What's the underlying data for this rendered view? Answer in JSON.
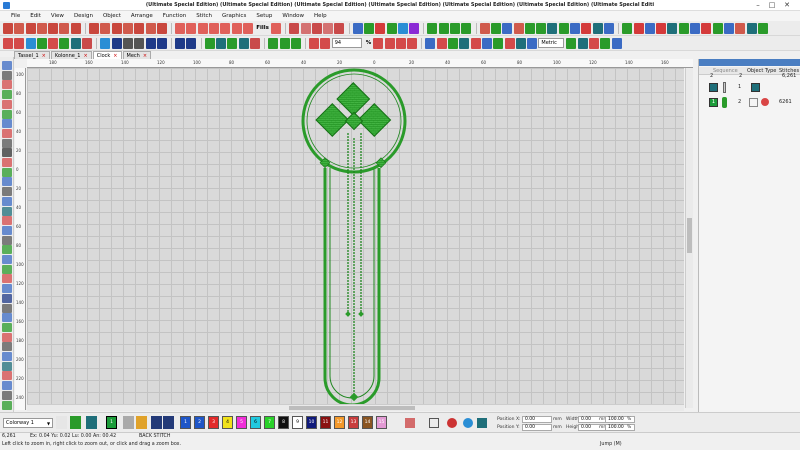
{
  "window": {
    "title": "(Ultimate Special Edition) (Ultimate Special Edition) (Ultimate Special Edition) (Ultimate Special Edition) (Ultimate Special Edition) (Ultimate Special Edition) (Ultimate Special Editi",
    "minimize": "–",
    "maximize": "□",
    "close": "✕"
  },
  "menu": [
    "File",
    "Edit",
    "View",
    "Design",
    "Object",
    "Arrange",
    "Function",
    "Stitch",
    "Graphics",
    "Setup",
    "Window",
    "Help"
  ],
  "toolbar": {
    "fills_label": "Fills",
    "zoom_value": "94",
    "zoom_unit": "%",
    "units_value": "Metric"
  },
  "tabs": [
    {
      "label": "Tassel_1",
      "active": false
    },
    {
      "label": "Kolonne_1",
      "active": false
    },
    {
      "label": "Clock",
      "active": true
    },
    {
      "label": "Mech",
      "active": false
    }
  ],
  "ruler": {
    "top": [
      "180",
      "160",
      "140",
      "120",
      "100",
      "80",
      "60",
      "40",
      "20",
      "0",
      "20",
      "40",
      "60",
      "80",
      "100",
      "120",
      "140",
      "160",
      "180"
    ],
    "left": [
      "100",
      "80",
      "60",
      "40",
      "20",
      "0",
      "20",
      "40",
      "60",
      "80",
      "100",
      "120",
      "140",
      "160",
      "180",
      "200",
      "220",
      "240"
    ]
  },
  "object_panel": {
    "columns": {
      "sequence": "Sequence",
      "object_type": "Object Type",
      "stitches": "Stitches"
    },
    "summary": {
      "a": "2",
      "b": "2",
      "stitches": "6,261"
    },
    "rows": [
      {
        "number": "1",
        "index": "1"
      },
      {
        "number": "1",
        "index": "2",
        "stitches": "6261"
      }
    ]
  },
  "bottom": {
    "colorway": "Colorway 1",
    "active_color_number": "1",
    "palette": [
      {
        "n": "1",
        "color": "#1f56c7"
      },
      {
        "n": "2",
        "color": "#1f56c7"
      },
      {
        "n": "3",
        "color": "#e22a2a"
      },
      {
        "n": "4",
        "color": "#f1e21a"
      },
      {
        "n": "5",
        "color": "#f02ed8"
      },
      {
        "n": "6",
        "color": "#21c9df"
      },
      {
        "n": "7",
        "color": "#2ad12a"
      },
      {
        "n": "8",
        "color": "#101010"
      },
      {
        "n": "9",
        "color": "#ffffff"
      },
      {
        "n": "10",
        "color": "#101a7a"
      },
      {
        "n": "11",
        "color": "#8a1212"
      },
      {
        "n": "12",
        "color": "#f2982a"
      },
      {
        "n": "13",
        "color": "#c73c3c"
      },
      {
        "n": "14",
        "color": "#8a5522"
      },
      {
        "n": "15",
        "color": "#e39ad4"
      }
    ],
    "position_x_label": "Position X:",
    "position_y_label": "Position Y:",
    "width_label": "Width:",
    "height_label": "Height:",
    "position_x": "0.00",
    "position_y": "0.00",
    "width": "0.00",
    "height": "0.00",
    "pct_w": "100.00",
    "pct_h": "100.00",
    "mm_a": "mm",
    "mm_b": "mm",
    "mm_c": "mm",
    "mm_d": "mm",
    "pct_a": "%",
    "pct_b": "%"
  },
  "status": {
    "stitch_count": "6,261",
    "coords": "Ex:    0.04 Yu:    0.02 Lu:    0.00 An:    00.42",
    "stitch_type": "BACK STITCH",
    "hint": "Left click to zoom in, right click to zoom out, or click and drag a zoom box.",
    "mode": "Jump (M)"
  },
  "colors": {
    "stitch_green": "#2a9b2a",
    "stitch_dark": "#157015",
    "grid_bg": "#d9d9d9",
    "panel_header": "#4a7ec2"
  }
}
